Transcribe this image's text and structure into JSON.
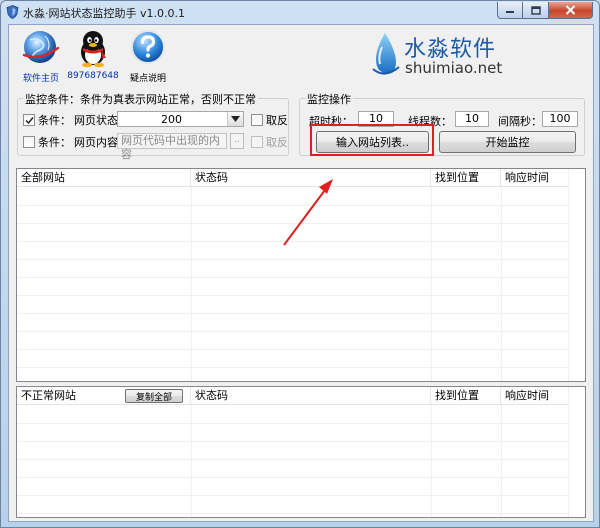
{
  "window": {
    "title": "水淼·网站状态监控助手 v1.0.0.1"
  },
  "toolbar": {
    "home_label": "软件主页",
    "qq_label": "897687648",
    "help_label": "疑点说明"
  },
  "brand": {
    "name_cn": "水淼软件",
    "name_en": "shuimiao.net"
  },
  "conditions": {
    "title": "监控条件：条件为真表示网站正常，否则不正常",
    "cond1": {
      "label": "条件：",
      "field": "网页状态",
      "value": "200",
      "checked": true,
      "invert_label": "取反"
    },
    "cond2": {
      "label": "条件：",
      "field": "网页内容",
      "placeholder": "网页代码中出现的内容",
      "browse_label": "..",
      "checked": false,
      "invert_label": "取反"
    }
  },
  "operations": {
    "title": "监控操作",
    "timeout_label": "超时秒：",
    "timeout_value": "10",
    "threads_label": "线程数：",
    "threads_value": "10",
    "interval_label": "间隔秒：",
    "interval_value": "100",
    "input_button": "输入网站列表..",
    "start_button": "开始监控"
  },
  "all_sites": {
    "columns": [
      "全部网站",
      "状态码",
      "找到位置",
      "响应时间"
    ]
  },
  "abnormal_sites": {
    "columns": [
      "不正常网站",
      "状态码",
      "找到位置",
      "响应时间"
    ],
    "copy_button": "复制全部"
  },
  "colors": {
    "highlight": "#e02020",
    "arrow": "#e02020",
    "brand_blue": "#1d5aa8"
  }
}
